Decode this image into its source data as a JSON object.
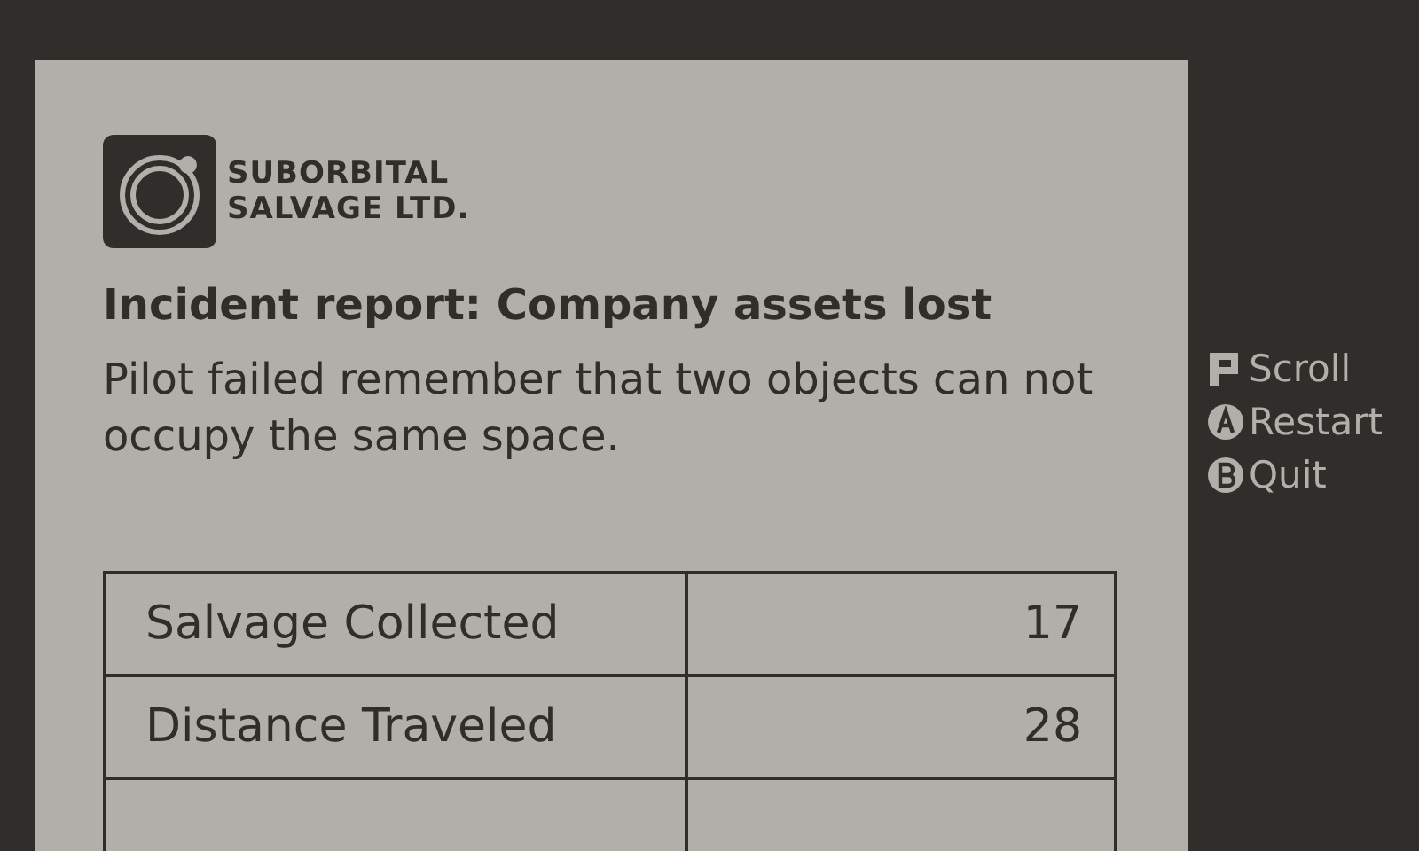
{
  "company": {
    "name_line_1": "SUBORBITAL",
    "name_line_2": "SALVAGE LTD."
  },
  "report": {
    "title": "Incident report: Company assets lost",
    "message": "Pilot failed remember that two objects can not occupy the same space."
  },
  "stats": [
    {
      "label": "Salvage Collected",
      "value": "17"
    },
    {
      "label": "Distance Traveled",
      "value": "28"
    }
  ],
  "controls": [
    {
      "kind": "dpad",
      "label": "Scroll"
    },
    {
      "kind": "a",
      "label": "Restart"
    },
    {
      "kind": "b",
      "label": "Quit"
    }
  ]
}
